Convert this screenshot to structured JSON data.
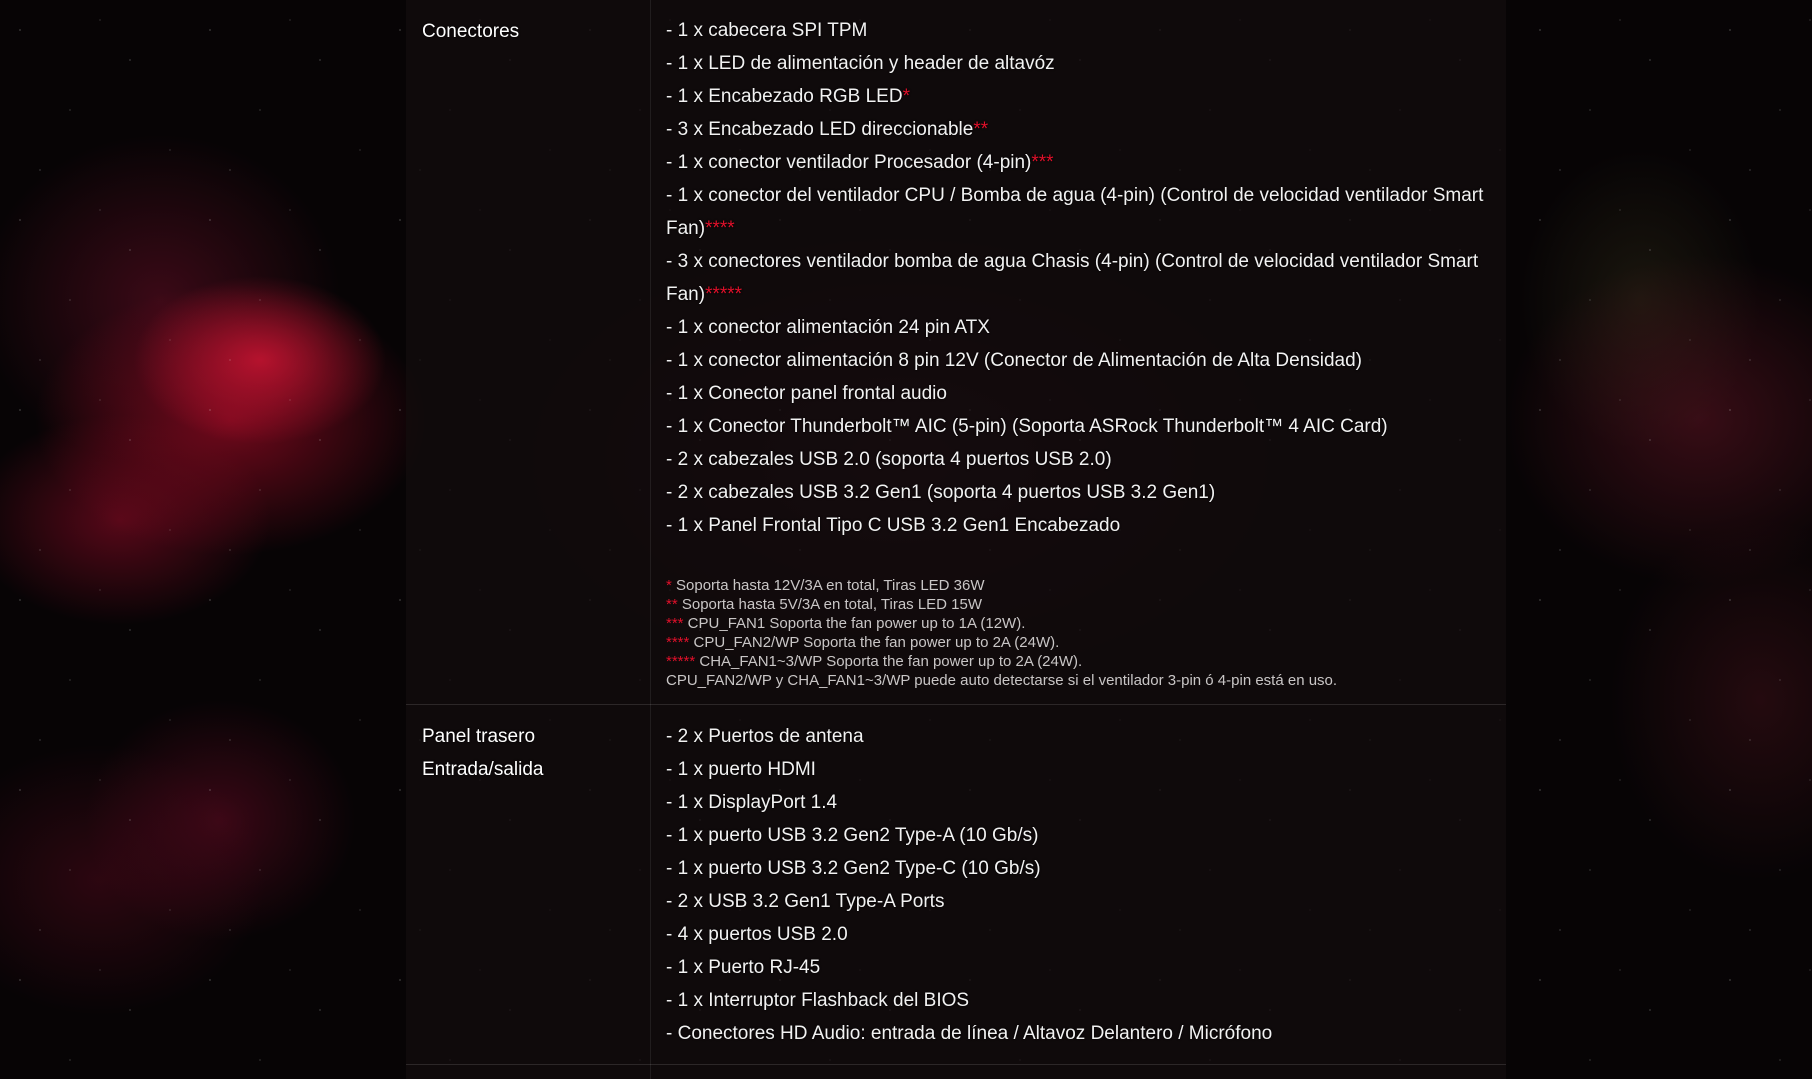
{
  "connectors": {
    "label": "Conectores",
    "items": [
      {
        "text": "- 1 x cabecera SPI TPM",
        "mark": ""
      },
      {
        "text": "- 1 x LED de alimentación y header de altavóz",
        "mark": ""
      },
      {
        "text": "- 1 x Encabezado RGB LED",
        "mark": "*"
      },
      {
        "text": "- 3 x Encabezado LED direccionable",
        "mark": "**"
      },
      {
        "text": "- 1 x conector ventilador Procesador (4-pin)",
        "mark": "***"
      },
      {
        "text": "- 1 x conector del ventilador CPU / Bomba de agua (4-pin) (Control de velocidad ventilador Smart Fan)",
        "mark": "****"
      },
      {
        "text": "- 3 x conectores ventilador bomba de agua Chasis (4-pin) (Control de velocidad ventilador Smart Fan)",
        "mark": "*****"
      },
      {
        "text": "- 1 x conector alimentación 24 pin ATX",
        "mark": ""
      },
      {
        "text": "- 1 x conector alimentación 8 pin 12V (Conector de Alimentación de Alta Densidad)",
        "mark": ""
      },
      {
        "text": "- 1 x Conector panel frontal audio",
        "mark": ""
      },
      {
        "text": "- 1 x Conector Thunderbolt™ AIC (5-pin) (Soporta ASRock Thunderbolt™ 4 AIC Card)",
        "mark": ""
      },
      {
        "text": "- 2 x cabezales USB 2.0 (soporta 4 puertos USB 2.0)",
        "mark": ""
      },
      {
        "text": "- 2 x cabezales USB 3.2 Gen1 (soporta 4 puertos USB 3.2 Gen1)",
        "mark": ""
      },
      {
        "text": "- 1 x Panel Frontal Tipo C USB 3.2 Gen1 Encabezado",
        "mark": ""
      }
    ],
    "notes": [
      {
        "mark": "*",
        "text": " Soporta hasta 12V/3A en total, Tiras LED 36W"
      },
      {
        "mark": "**",
        "text": " Soporta hasta 5V/3A en total, Tiras LED 15W"
      },
      {
        "mark": "***",
        "text": " CPU_FAN1 Soporta the fan power up to 1A (12W)."
      },
      {
        "mark": "****",
        "text": " CPU_FAN2/WP Soporta the fan power up to 2A (24W)."
      },
      {
        "mark": "*****",
        "text": " CHA_FAN1~3/WP Soporta the fan power up to 2A (24W)."
      },
      {
        "mark": "",
        "text": "CPU_FAN2/WP y CHA_FAN1~3/WP puede auto detectarse si el ventilador 3-pin ó 4-pin está en uso."
      }
    ]
  },
  "rear_panel": {
    "label_line1": "Panel trasero",
    "label_line2": "Entrada/salida",
    "items": [
      "- 2 x Puertos de antena",
      "- 1 x puerto HDMI",
      "- 1 x DisplayPort 1.4",
      "- 1 x puerto USB 3.2 Gen2 Type-A (10 Gb/s)",
      "- 1 x puerto USB 3.2 Gen2 Type-C (10 Gb/s)",
      "- 2 x USB 3.2 Gen1 Type-A Ports",
      "- 4 x puertos USB 2.0",
      "- 1 x Puerto RJ-45",
      "- 1 x Interruptor Flashback del BIOS",
      "- Conectores HD Audio: entrada de línea / Altavoz Delantero / Micrófono"
    ]
  },
  "colors": {
    "accent_red": "#e0102a",
    "text": "#f2f2f2",
    "note_text": "#c9c6c6"
  }
}
